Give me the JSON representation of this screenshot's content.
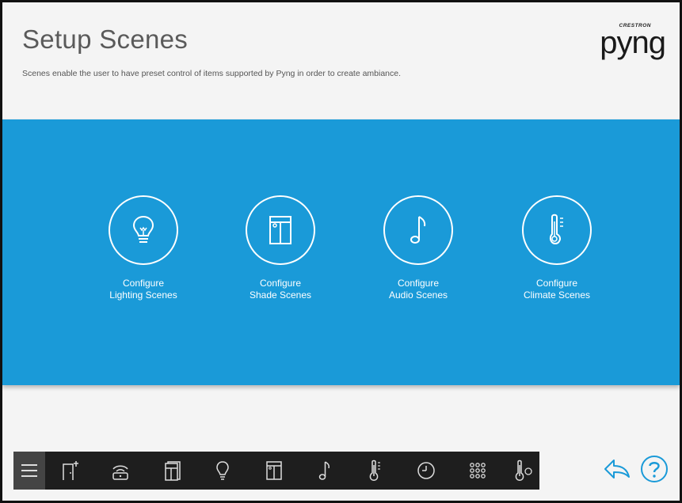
{
  "header": {
    "title": "Setup Scenes",
    "subtitle": "Scenes enable the user to have preset control of items supported by Pyng in order to create ambiance.",
    "logo_small": "CRESTRON",
    "logo_main": "pyng"
  },
  "scenes": [
    {
      "line1": "Configure",
      "line2": "Lighting Scenes",
      "icon": "lightbulb-icon"
    },
    {
      "line1": "Configure",
      "line2": "Shade Scenes",
      "icon": "shade-icon"
    },
    {
      "line1": "Configure",
      "line2": "Audio Scenes",
      "icon": "music-note-icon"
    },
    {
      "line1": "Configure",
      "line2": "Climate Scenes",
      "icon": "thermometer-icon"
    }
  ],
  "bottom_bar": {
    "items": [
      "menu-icon",
      "add-room-icon",
      "remote-icon",
      "devices-icon",
      "lightbulb-icon",
      "shade-icon",
      "music-note-icon",
      "thermometer-icon",
      "clock-icon",
      "keypad-icon",
      "thermostat-icon"
    ]
  },
  "actions": [
    "back-icon",
    "help-icon"
  ],
  "colors": {
    "accent": "#1a9ad8",
    "bar": "#1e1e1e",
    "icon_blue": "#1a9ad8"
  }
}
